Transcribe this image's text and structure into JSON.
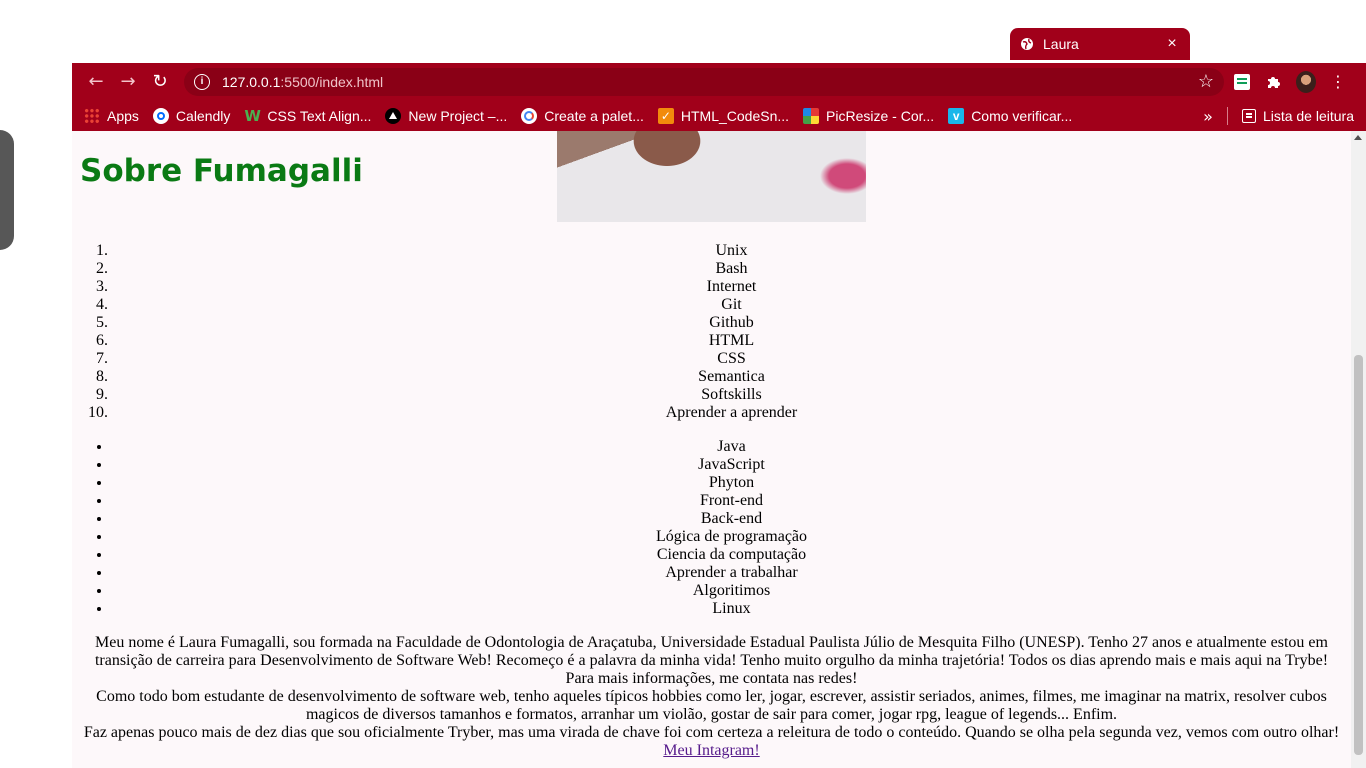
{
  "browser": {
    "tab": {
      "title": "Laura",
      "close": "×"
    },
    "address_bar": {
      "host": "127.0.0.1",
      "rest": ":5500/index.html"
    },
    "bookmarks": [
      {
        "label": "Apps"
      },
      {
        "label": "Calendly"
      },
      {
        "label": "CSS Text Align..."
      },
      {
        "label": "New Project –..."
      },
      {
        "label": "Create a palet..."
      },
      {
        "label": "HTML_CodeSn..."
      },
      {
        "label": "PicResize - Cor..."
      },
      {
        "label": "Como verificar..."
      }
    ],
    "more_bookmarks": "»",
    "reading_list": "Lista de leitura"
  },
  "page": {
    "title": "Sobre Fumagalli",
    "ordered_list": [
      "Unix",
      "Bash",
      "Internet",
      "Git",
      "Github",
      "HTML",
      "CSS",
      "Semantica",
      "Softskills",
      "Aprender a aprender"
    ],
    "unordered_list": [
      "Java",
      "JavaScript",
      "Phyton",
      "Front-end",
      "Back-end",
      "Lógica de programação",
      "Ciencia da computação",
      "Aprender a trabalhar",
      "Algoritimos",
      "Linux"
    ],
    "about_lines": [
      "Meu nome é Laura Fumagalli, sou formada na Faculdade de Odontologia de Araçatuba, Universidade Estadual Paulista Júlio de Mesquita Filho (UNESP). Tenho 27 anos e atualmente estou em transição de carreira para Desenvolvimento de Software Web! Recomeço é a palavra da minha vida! Tenho muito orgulho da minha trajetória! Todos os dias aprendo mais e mais aqui na Trybe!",
      "Para mais informações, me contata nas redes!",
      "Como todo bom estudante de desenvolvimento de software web, tenho aqueles típicos hobbies como ler, jogar, escrever, assistir seriados, animes, filmes, me imaginar na matrix, resolver cubos magicos de diversos tamanhos e formatos, arranhar um violão, gostar de sair para comer, jogar rpg, league of legends... Enfim.",
      "Faz apenas pouco mais de dez dias que sou oficialmente Tryber, mas uma virada de chave foi com certeza a releitura de todo o conteúdo. Quando se olha pela segunda vez, vemos com outro olhar!"
    ],
    "instagram_link": "Meu Intagram!"
  }
}
